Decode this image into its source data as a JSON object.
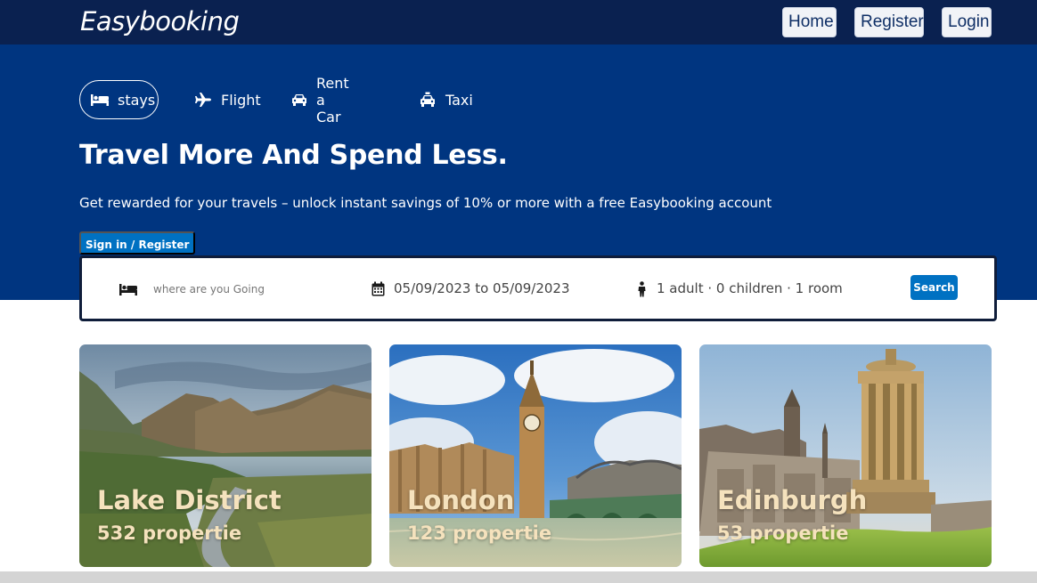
{
  "header": {
    "brand": "Easybooking",
    "nav": {
      "home": "Home",
      "register": "Register",
      "login": "Login"
    }
  },
  "hero": {
    "tabs": [
      {
        "label": "stays",
        "icon": "bed-icon"
      },
      {
        "label": "Flight",
        "icon": "plane-icon"
      },
      {
        "label": "Rent a Car",
        "icon": "car-icon"
      },
      {
        "label": "Taxi",
        "icon": "taxi-icon"
      }
    ],
    "title": "Travel More And Spend Less.",
    "subtitle": "Get rewarded for your travels – unlock instant savings of 10% or more with a free Easybooking account",
    "signin_label": "Sign in / Register"
  },
  "search": {
    "destination_placeholder": "where are you Going",
    "dates": "05/09/2023 to 05/09/2023",
    "guests": "1 adult · 0 children · 1 room",
    "button_label": "Search"
  },
  "destinations": [
    {
      "name": "Lake District",
      "count": "532 propertie"
    },
    {
      "name": "London",
      "count": "123 propertie"
    },
    {
      "name": "Edinburgh",
      "count": "53 propertie"
    }
  ],
  "colors": {
    "navbar": "#0a2150",
    "hero": "#003580",
    "accent": "#0071c2",
    "card_text": "#f5e2bd"
  }
}
